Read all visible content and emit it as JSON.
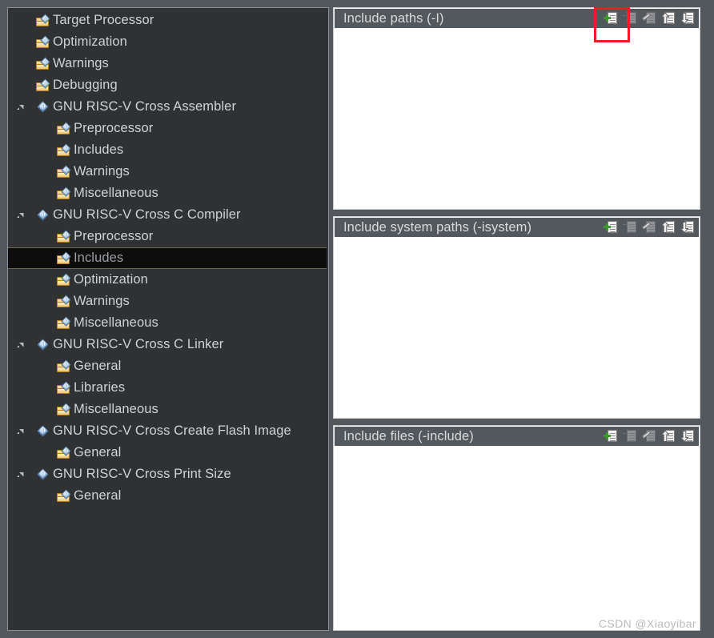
{
  "window": {
    "background_color": "#53585c"
  },
  "tree": {
    "name": "build-settings-tree",
    "items": [
      {
        "label": "Target Processor",
        "depth": 1,
        "icon": "folder-tool-icon",
        "expandable": false,
        "expanded": false,
        "selected": false
      },
      {
        "label": "Optimization",
        "depth": 1,
        "icon": "folder-tool-icon",
        "expandable": false,
        "expanded": false,
        "selected": false
      },
      {
        "label": "Warnings",
        "depth": 1,
        "icon": "folder-tool-icon",
        "expandable": false,
        "expanded": false,
        "selected": false
      },
      {
        "label": "Debugging",
        "depth": 1,
        "icon": "folder-tool-icon",
        "expandable": false,
        "expanded": false,
        "selected": false
      },
      {
        "label": "GNU RISC-V Cross Assembler",
        "depth": 1,
        "icon": "tool-icon",
        "expandable": true,
        "expanded": true,
        "selected": false
      },
      {
        "label": "Preprocessor",
        "depth": 2,
        "icon": "folder-tool-icon",
        "expandable": false,
        "expanded": false,
        "selected": false
      },
      {
        "label": "Includes",
        "depth": 2,
        "icon": "folder-tool-icon",
        "expandable": false,
        "expanded": false,
        "selected": false
      },
      {
        "label": "Warnings",
        "depth": 2,
        "icon": "folder-tool-icon",
        "expandable": false,
        "expanded": false,
        "selected": false
      },
      {
        "label": "Miscellaneous",
        "depth": 2,
        "icon": "folder-tool-icon",
        "expandable": false,
        "expanded": false,
        "selected": false
      },
      {
        "label": "GNU RISC-V Cross C Compiler",
        "depth": 1,
        "icon": "tool-icon",
        "expandable": true,
        "expanded": true,
        "selected": false
      },
      {
        "label": "Preprocessor",
        "depth": 2,
        "icon": "folder-tool-icon",
        "expandable": false,
        "expanded": false,
        "selected": false
      },
      {
        "label": "Includes",
        "depth": 2,
        "icon": "folder-tool-icon",
        "expandable": false,
        "expanded": false,
        "selected": true
      },
      {
        "label": "Optimization",
        "depth": 2,
        "icon": "folder-tool-icon",
        "expandable": false,
        "expanded": false,
        "selected": false
      },
      {
        "label": "Warnings",
        "depth": 2,
        "icon": "folder-tool-icon",
        "expandable": false,
        "expanded": false,
        "selected": false
      },
      {
        "label": "Miscellaneous",
        "depth": 2,
        "icon": "folder-tool-icon",
        "expandable": false,
        "expanded": false,
        "selected": false
      },
      {
        "label": "GNU RISC-V Cross C Linker",
        "depth": 1,
        "icon": "tool-icon",
        "expandable": true,
        "expanded": true,
        "selected": false
      },
      {
        "label": "General",
        "depth": 2,
        "icon": "folder-tool-icon",
        "expandable": false,
        "expanded": false,
        "selected": false
      },
      {
        "label": "Libraries",
        "depth": 2,
        "icon": "folder-tool-icon",
        "expandable": false,
        "expanded": false,
        "selected": false
      },
      {
        "label": "Miscellaneous",
        "depth": 2,
        "icon": "folder-tool-icon",
        "expandable": false,
        "expanded": false,
        "selected": false
      },
      {
        "label": "GNU RISC-V Cross Create Flash Image",
        "depth": 1,
        "icon": "tool-icon",
        "expandable": true,
        "expanded": true,
        "selected": false
      },
      {
        "label": "General",
        "depth": 2,
        "icon": "folder-tool-icon",
        "expandable": false,
        "expanded": false,
        "selected": false
      },
      {
        "label": "GNU RISC-V Cross Print Size",
        "depth": 1,
        "icon": "tool-icon",
        "expandable": true,
        "expanded": true,
        "selected": false
      },
      {
        "label": "General",
        "depth": 2,
        "icon": "folder-tool-icon",
        "expandable": false,
        "expanded": false,
        "selected": false
      }
    ]
  },
  "panels": [
    {
      "id": "include-paths",
      "title": "Include paths (-I)",
      "entries": [],
      "tools": [
        {
          "name": "add-icon",
          "tooltip": "Add"
        },
        {
          "name": "delete-icon",
          "tooltip": "Delete"
        },
        {
          "name": "edit-icon",
          "tooltip": "Edit"
        },
        {
          "name": "move-up-icon",
          "tooltip": "Move up"
        },
        {
          "name": "move-down-icon",
          "tooltip": "Move down"
        }
      ]
    },
    {
      "id": "include-system-paths",
      "title": "Include system paths (-isystem)",
      "entries": [],
      "tools": [
        {
          "name": "add-icon",
          "tooltip": "Add"
        },
        {
          "name": "delete-icon",
          "tooltip": "Delete"
        },
        {
          "name": "edit-icon",
          "tooltip": "Edit"
        },
        {
          "name": "move-up-icon",
          "tooltip": "Move up"
        },
        {
          "name": "move-down-icon",
          "tooltip": "Move down"
        }
      ]
    },
    {
      "id": "include-files",
      "title": "Include files (-include)",
      "entries": [],
      "tools": [
        {
          "name": "add-icon",
          "tooltip": "Add"
        },
        {
          "name": "delete-icon",
          "tooltip": "Delete"
        },
        {
          "name": "edit-icon",
          "tooltip": "Edit"
        },
        {
          "name": "move-up-icon",
          "tooltip": "Move up"
        },
        {
          "name": "move-down-icon",
          "tooltip": "Move down"
        }
      ]
    }
  ],
  "annotation": {
    "name": "highlight-rectangle",
    "color": "#ee1c25",
    "targets": "add-icon of include-paths panel"
  },
  "watermark": {
    "text": "CSDN @Xiaoyibar"
  }
}
